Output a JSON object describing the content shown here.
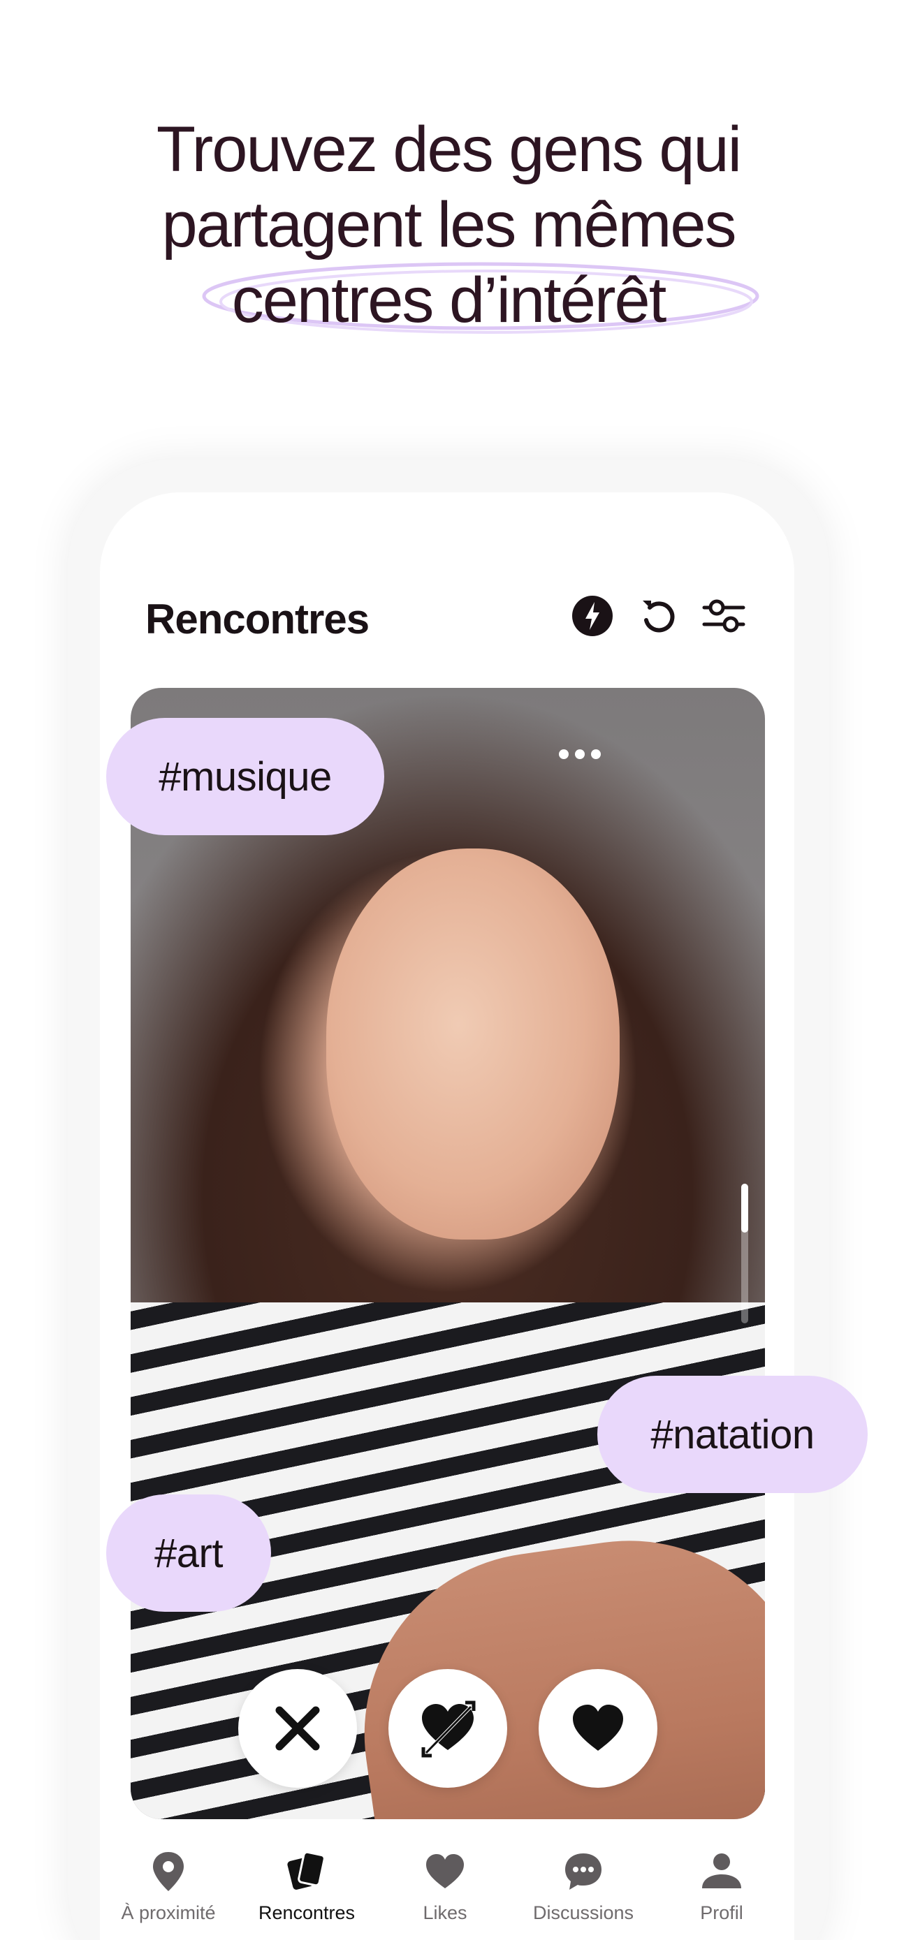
{
  "headline": {
    "line1": "Trouvez des gens qui",
    "line2": "partagent les mêmes",
    "line3": "centres d’intérêt"
  },
  "app": {
    "title": "Rencontres",
    "header_icons": [
      "lightning-icon",
      "undo-icon",
      "filter-sliders-icon"
    ]
  },
  "profile_card": {
    "more_icon": "more-dots-icon",
    "tags": [
      "#musique",
      "#natation",
      "#art"
    ]
  },
  "actions": {
    "pass": "close-icon",
    "crush": "heart-arrow-icon",
    "like": "heart-icon"
  },
  "tabs": [
    {
      "label": "À proximité",
      "icon": "location-pin-icon",
      "active": false
    },
    {
      "label": "Rencontres",
      "icon": "cards-icon",
      "active": true
    },
    {
      "label": "Likes",
      "icon": "heart-icon",
      "active": false
    },
    {
      "label": "Discussions",
      "icon": "chat-bubble-icon",
      "active": false
    },
    {
      "label": "Profil",
      "icon": "person-icon",
      "active": false
    }
  ],
  "colors": {
    "tag_background": "#e9d8fb",
    "headline": "#2d1522",
    "highlight_ring": "#dcc6f5",
    "dark": "#1a1216"
  }
}
